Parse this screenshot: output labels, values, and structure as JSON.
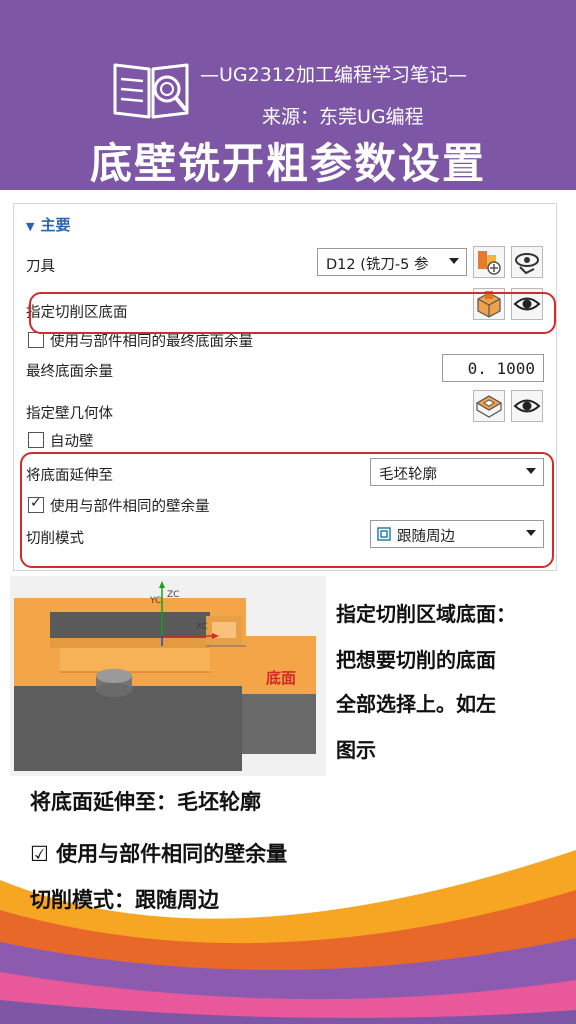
{
  "header": {
    "subtitle": "—UG2312加工编程学习笔记—",
    "source": "来源：东莞UG编程",
    "title": "底壁铣开粗参数设置"
  },
  "panel": {
    "section": "主要",
    "tool_label": "刀具",
    "tool_value": "D12 (铣刀-5 参",
    "cut_area_label": "指定切削区底面",
    "same_floor_stock_label": "使用与部件相同的最终底面余量",
    "same_floor_stock_checked": false,
    "final_floor_stock_label": "最终底面余量",
    "final_floor_stock_value": "0. 1000",
    "wall_geometry_label": "指定壁几何体",
    "auto_wall_label": "自动壁",
    "auto_wall_checked": false,
    "extend_floor_label": "将底面延伸至",
    "extend_floor_value": "毛坯轮廓",
    "same_wall_stock_label": "使用与部件相同的壁余量",
    "same_wall_stock_checked": true,
    "cut_pattern_label": "切削模式",
    "cut_pattern_value": "跟随周边"
  },
  "model": {
    "floor_label": "底面",
    "axis_labels": [
      "YC",
      "ZC",
      "XC"
    ]
  },
  "notes": {
    "lines": [
      "指定切削区域底面：",
      "把想要切削的底面",
      "全部选择上。如左",
      "图示"
    ],
    "bottom1": "将底面延伸至：毛坯轮廓",
    "bottom2": "☑ 使用与部件相同的壁余量",
    "bottom3": "切削模式：跟随周边"
  },
  "colors": {
    "header_bg": "#7d57a5",
    "model_orange": "#f4a547",
    "highlight_red": "#d42a2a",
    "accent_blue": "#2a63b0"
  }
}
